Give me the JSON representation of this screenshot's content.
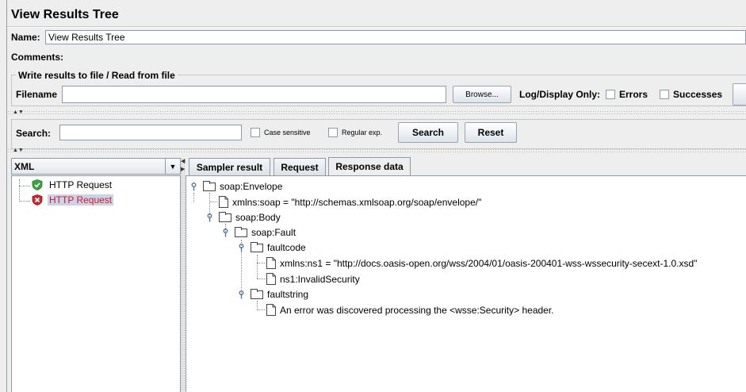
{
  "window": {
    "title": "View Results Tree"
  },
  "name_field": {
    "label": "Name:",
    "value": "View Results Tree"
  },
  "comments": {
    "label": "Comments:"
  },
  "file_group": {
    "legend": "Write results to file / Read from file",
    "filename_label": "Filename",
    "filename_value": "",
    "browse_label": "Browse...",
    "log_display_label": "Log/Display Only:",
    "errors_label": "Errors",
    "successes_label": "Successes"
  },
  "search": {
    "label": "Search:",
    "value": "",
    "case_sensitive_label": "Case sensitive",
    "regex_label": "Regular exp.",
    "search_button": "Search",
    "reset_button": "Reset"
  },
  "renderer": {
    "selected": "XML"
  },
  "samples": [
    {
      "label": "HTTP Request",
      "status": "success"
    },
    {
      "label": "HTTP Request",
      "status": "error"
    }
  ],
  "tabs": [
    {
      "label": "Sampler result"
    },
    {
      "label": "Request"
    },
    {
      "label": "Response data"
    }
  ],
  "xml_tree": [
    {
      "text": "soap:Envelope",
      "kind": "element"
    },
    {
      "text": "xmlns:soap = \"http://schemas.xmlsoap.org/soap/envelope/\"",
      "kind": "attribute"
    },
    {
      "text": "soap:Body",
      "kind": "element"
    },
    {
      "text": "soap:Fault",
      "kind": "element"
    },
    {
      "text": "faultcode",
      "kind": "element"
    },
    {
      "text": "xmlns:ns1 = \"http://docs.oasis-open.org/wss/2004/01/oasis-200401-wss-wssecurity-secext-1.0.xsd\"",
      "kind": "attribute"
    },
    {
      "text": "ns1:InvalidSecurity",
      "kind": "text"
    },
    {
      "text": "faultstring",
      "kind": "element"
    },
    {
      "text": "An error was discovered processing the <wsse:Security> header.",
      "kind": "text"
    }
  ],
  "colors": {
    "success": "#3aa53a",
    "error": "#d0262a",
    "error_text": "#e0141e",
    "selection": "#c7d5ea"
  },
  "icons": {
    "success": "check-shield-icon",
    "error": "x-shield-icon",
    "element": "folder-icon",
    "leaf": "document-icon",
    "expand": "tree-key-icon"
  }
}
